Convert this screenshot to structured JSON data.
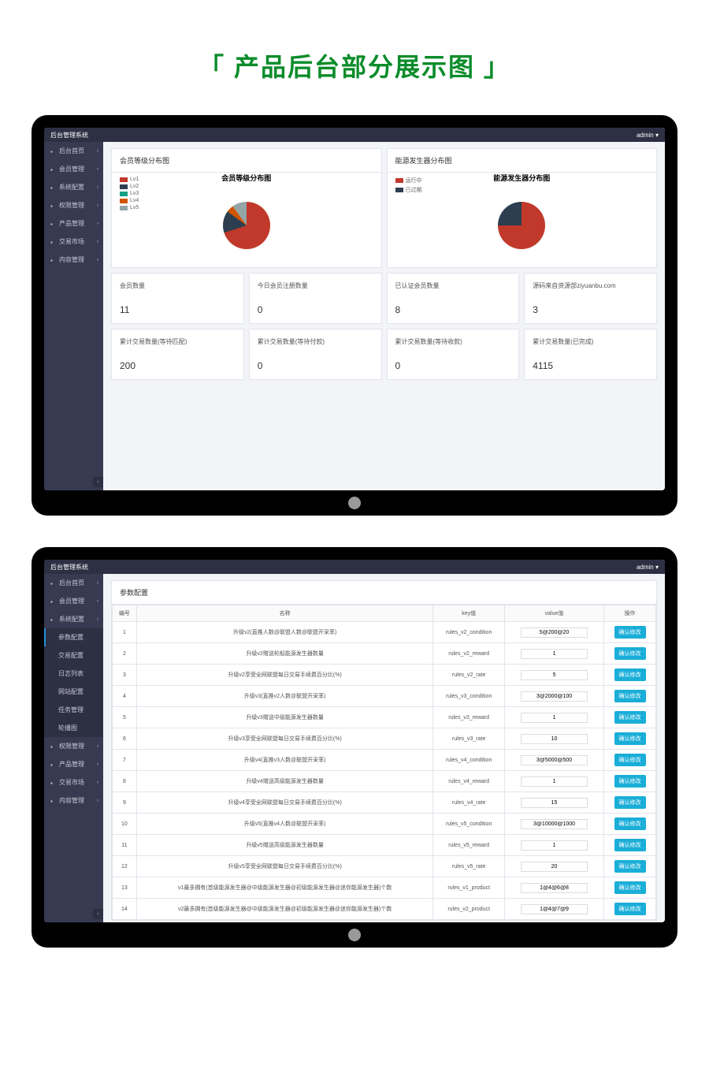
{
  "page_title": "「 产品后台部分展示图 」",
  "header": {
    "brand": "后台管理系统",
    "user": "admin ▾"
  },
  "sidebar1": {
    "items": [
      {
        "label": "后台首页",
        "icon": "home"
      },
      {
        "label": "会员管理",
        "icon": "users"
      },
      {
        "label": "系统配置",
        "icon": "cog"
      },
      {
        "label": "权限管理",
        "icon": "lock"
      },
      {
        "label": "产品管理",
        "icon": "cube"
      },
      {
        "label": "交易市场",
        "icon": "exchange"
      },
      {
        "label": "内容管理",
        "icon": "file"
      }
    ]
  },
  "sidebar2": {
    "items": [
      {
        "label": "后台首页",
        "icon": "home"
      },
      {
        "label": "会员管理",
        "icon": "users"
      },
      {
        "label": "系统配置",
        "icon": "cog",
        "expanded": true
      },
      {
        "label": "参数配置",
        "sub": true,
        "active": true
      },
      {
        "label": "交易配置",
        "sub": true
      },
      {
        "label": "日志列表",
        "sub": true
      },
      {
        "label": "网站配置",
        "sub": true
      },
      {
        "label": "任务管理",
        "sub": true
      },
      {
        "label": "轮播图",
        "sub": true
      },
      {
        "label": "权限管理",
        "icon": "lock"
      },
      {
        "label": "产品管理",
        "icon": "cube"
      },
      {
        "label": "交易市场",
        "icon": "exchange"
      },
      {
        "label": "内容管理",
        "icon": "file"
      }
    ]
  },
  "dashboard": {
    "chart1": {
      "card_title": "会员等级分布图",
      "chart_title": "会员等级分布图",
      "legend": [
        {
          "label": "Lv1",
          "color": "#c0392b"
        },
        {
          "label": "Lv2",
          "color": "#2c3e50"
        },
        {
          "label": "Lv3",
          "color": "#16a085"
        },
        {
          "label": "Lv4",
          "color": "#d35400"
        },
        {
          "label": "Lv5",
          "color": "#95a5a6"
        }
      ],
      "labels_around": [
        "Lv1",
        "Lv2",
        "Lv4",
        "Lv5"
      ]
    },
    "chart2": {
      "card_title": "能源发生器分布图",
      "chart_title": "能源发生器分布图",
      "legend": [
        {
          "label": "运行中",
          "color": "#c0392b"
        },
        {
          "label": "已过期",
          "color": "#2c3e50"
        }
      ],
      "labels_around": [
        "运行中",
        "已过期"
      ]
    },
    "stats_row1": [
      {
        "label": "会员数量",
        "value": "11"
      },
      {
        "label": "今日会员注册数量",
        "value": "0"
      },
      {
        "label": "已认证会员数量",
        "value": "8"
      },
      {
        "label": "源码来自资源部ziyuanbu.com",
        "value": "3"
      }
    ],
    "stats_row2": [
      {
        "label": "累计交易数量(等待匹配)",
        "value": "200"
      },
      {
        "label": "累计交易数量(等待付款)",
        "value": "0"
      },
      {
        "label": "累计交易数量(等待收款)",
        "value": "0"
      },
      {
        "label": "累计交易数量(已完成)",
        "value": "4115"
      }
    ]
  },
  "params": {
    "title": "参数配置",
    "headers": [
      "编号",
      "名称",
      "key值",
      "value值",
      "操作"
    ],
    "edit_label": "确认修改",
    "rows": [
      {
        "id": "1",
        "name": "升级v2(直推人数@联盟人数@联盟开采率)",
        "key": "rules_v2_condition",
        "value": "5@200@20"
      },
      {
        "id": "2",
        "name": "升级v2赠送轮船能源发生器数量",
        "key": "rules_v2_reward",
        "value": "1"
      },
      {
        "id": "3",
        "name": "升级v2享受全网联盟每日交易手续费百分比(%)",
        "key": "rules_v2_rate",
        "value": "5"
      },
      {
        "id": "4",
        "name": "升级v3(直推v2人数@联盟开采率)",
        "key": "rules_v3_condition",
        "value": "3@2000@100"
      },
      {
        "id": "5",
        "name": "升级v3赠送中级能源发生器数量",
        "key": "rules_v3_reward",
        "value": "1"
      },
      {
        "id": "6",
        "name": "升级v3享受全网联盟每日交易手续费百分比(%)",
        "key": "rules_v3_rate",
        "value": "10"
      },
      {
        "id": "7",
        "name": "升级v4(直推v3人数@联盟开采率)",
        "key": "rules_v4_condition",
        "value": "3@5000@500"
      },
      {
        "id": "8",
        "name": "升级v4赠送高级能源发生器数量",
        "key": "rules_v4_reward",
        "value": "1"
      },
      {
        "id": "9",
        "name": "升级v4享受全网联盟每日交易手续费百分比(%)",
        "key": "rules_v4_rate",
        "value": "15"
      },
      {
        "id": "10",
        "name": "升级v5(直推v4人数@联盟开采率)",
        "key": "rules_v5_condition",
        "value": "3@10000@1000"
      },
      {
        "id": "11",
        "name": "升级v5赠送高级能源发生器数量",
        "key": "rules_v5_reward",
        "value": "1"
      },
      {
        "id": "12",
        "name": "升级v5享受全网联盟每日交易手续费百分比(%)",
        "key": "rules_v5_rate",
        "value": "20"
      },
      {
        "id": "13",
        "name": "v1最多拥有(首级能源发生器@中级能源发生器@初级能源发生器@迷你能源发生器)个数",
        "key": "rules_v1_product",
        "value": "1@4@6@8"
      },
      {
        "id": "14",
        "name": "v2最多拥有(首级能源发生器@中级能源发生器@初级能源发生器@迷你能源发生器)个数",
        "key": "rules_v2_product",
        "value": "1@4@7@9"
      }
    ]
  },
  "chart_data": [
    {
      "type": "pie",
      "title": "会员等级分布图",
      "categories": [
        "Lv1",
        "Lv2",
        "Lv3",
        "Lv4",
        "Lv5"
      ],
      "values": [
        70,
        15,
        0,
        5,
        10
      ],
      "colors": [
        "#c0392b",
        "#2c3e50",
        "#16a085",
        "#d35400",
        "#95a5a6"
      ]
    },
    {
      "type": "pie",
      "title": "能源发生器分布图",
      "categories": [
        "运行中",
        "已过期"
      ],
      "values": [
        75,
        25
      ],
      "colors": [
        "#c0392b",
        "#2c3e50"
      ]
    }
  ]
}
